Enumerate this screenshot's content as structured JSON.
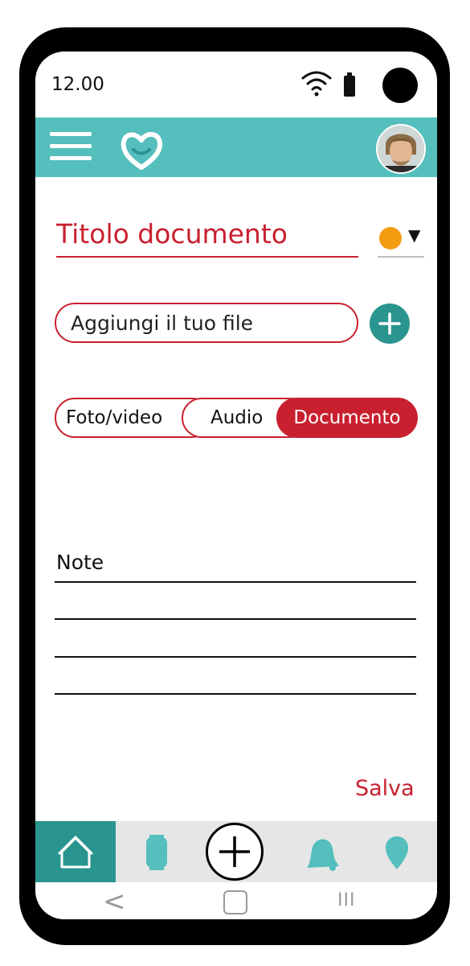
{
  "status_bar": {
    "time": "12.00"
  },
  "app_bar": {
    "menu_icon": "hamburger-menu-icon",
    "logo_icon": "heart-logo-icon",
    "avatar_icon": "user-avatar"
  },
  "document": {
    "title_placeholder": "Titolo documento",
    "color_marker": "#f39c12"
  },
  "file": {
    "placeholder": "Aggiungi il tuo file",
    "add_icon": "plus-icon"
  },
  "media_type": {
    "options": [
      "Foto/video",
      "Audio",
      "Documento"
    ],
    "selected": "Documento"
  },
  "notes": {
    "label": "Note"
  },
  "actions": {
    "save_label": "Salva"
  },
  "bottom_nav": {
    "items": [
      "home-icon",
      "watch-icon",
      "add-icon",
      "bell-icon",
      "location-pin-icon"
    ],
    "active": "home-icon"
  },
  "system_nav": {
    "back": "<",
    "recent": "III"
  },
  "colors": {
    "accent": "#55bfbd",
    "dark_accent": "#2a958e",
    "brand_red": "#c8202f"
  }
}
